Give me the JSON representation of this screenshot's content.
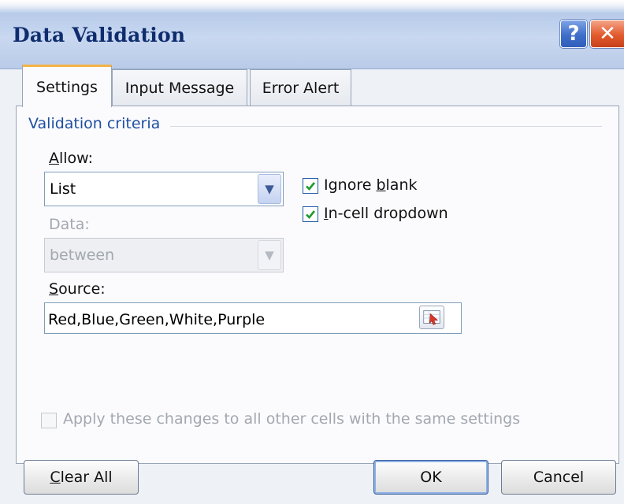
{
  "window": {
    "title": "Data Validation",
    "help_glyph": "?",
    "close_glyph": "✕"
  },
  "tabs": [
    {
      "label": "Settings",
      "active": true
    },
    {
      "label": "Input Message",
      "active": false
    },
    {
      "label": "Error Alert",
      "active": false
    }
  ],
  "criteria": {
    "group_label": "Validation criteria",
    "allow": {
      "label_key": "A",
      "label_rest": "llow:",
      "value": "List"
    },
    "data": {
      "label": "Data:",
      "value": "between",
      "enabled": false
    },
    "ignore_blank": {
      "label_pre": "Ignore ",
      "label_key": "b",
      "label_post": "lank",
      "checked": true
    },
    "in_cell_dropdown": {
      "label_key": "I",
      "label_rest": "n-cell dropdown",
      "checked": true
    },
    "source": {
      "label_key": "S",
      "label_rest": "ource:",
      "value": "Red,Blue,Green,White,Purple"
    },
    "apply_all": {
      "label": "Apply these changes to all other cells with the same settings",
      "checked": false,
      "enabled": false
    }
  },
  "buttons": {
    "clear_all": {
      "label_key": "C",
      "label_rest": "lear All"
    },
    "ok": "OK",
    "cancel": "Cancel"
  },
  "colors": {
    "accent_tab": "#f2b347",
    "group_label": "#1f4ea0",
    "title_text": "#0f2d6e"
  }
}
